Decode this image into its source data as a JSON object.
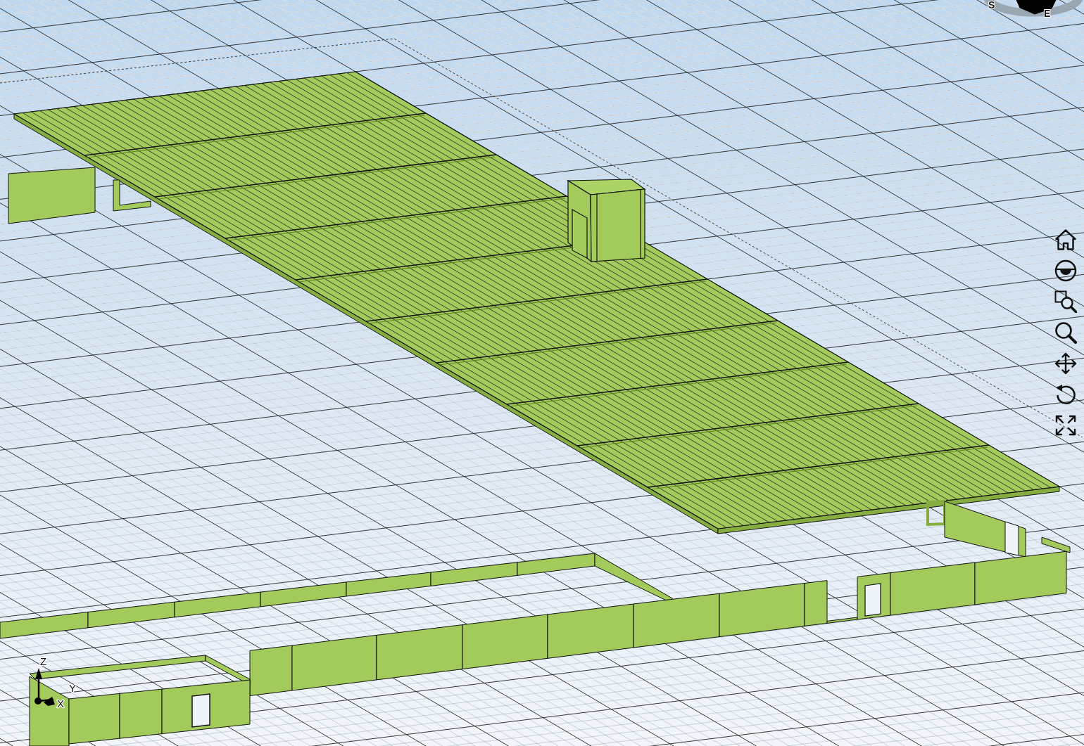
{
  "view_cube": {
    "compass_labels": [
      {
        "text": "S"
      },
      {
        "text": "E"
      }
    ]
  },
  "axis_triad": [
    {
      "text": "Z"
    },
    {
      "text": "Y"
    },
    {
      "text": "X"
    }
  ],
  "navigation_toolbar": [
    {
      "kind": "home"
    },
    {
      "kind": "look"
    },
    {
      "kind": "zoom_window"
    },
    {
      "kind": "zoom"
    },
    {
      "kind": "pan"
    },
    {
      "kind": "orbit"
    },
    {
      "kind": "fit"
    }
  ]
}
